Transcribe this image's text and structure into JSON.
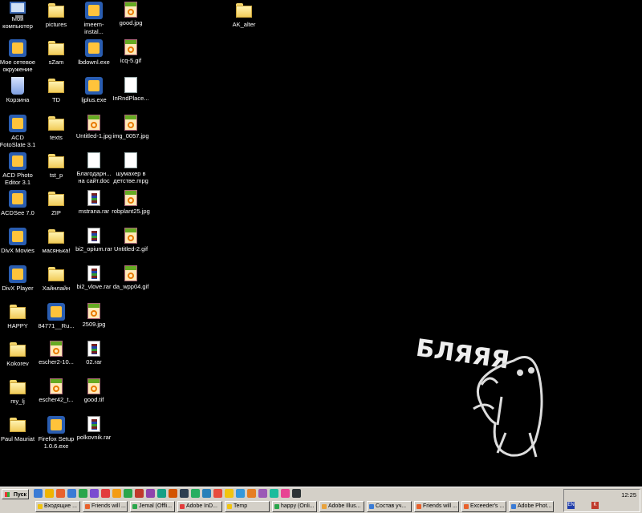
{
  "desktop": {
    "icons": [
      {
        "label": "Мой компьютер",
        "type": "pc"
      },
      {
        "label": "Мое сетевое окружение",
        "type": "app"
      },
      {
        "label": "Корзина",
        "type": "trash"
      },
      {
        "label": "ACD FotoSlate 3.1",
        "type": "app"
      },
      {
        "label": "ACD Photo Editor 3.1",
        "type": "app"
      },
      {
        "label": "ACDSee 7.0",
        "type": "app"
      },
      {
        "label": "DivX Movies",
        "type": "app"
      },
      {
        "label": "DivX Player",
        "type": "app"
      },
      {
        "label": "HAPPY",
        "type": "folder"
      },
      {
        "label": "Kokorev",
        "type": "folder"
      },
      {
        "label": "my_lj",
        "type": "folder"
      },
      {
        "label": "Paul Mauriat",
        "type": "folder"
      },
      {
        "label": "pictures",
        "type": "folder"
      },
      {
        "label": "sZam",
        "type": "folder"
      },
      {
        "label": "TD",
        "type": "folder"
      },
      {
        "label": "texts",
        "type": "folder"
      },
      {
        "label": "tst_p",
        "type": "folder"
      },
      {
        "label": "ZIP",
        "type": "folder"
      },
      {
        "label": "масянька!",
        "type": "folder"
      },
      {
        "label": "Хайнлайн",
        "type": "folder"
      },
      {
        "label": "84771__Ru...",
        "type": "app"
      },
      {
        "label": "escher2-10...",
        "type": "img"
      },
      {
        "label": "escher42_t...",
        "type": "img"
      },
      {
        "label": "Firefox Setup 1.0.6.exe",
        "type": "app"
      },
      {
        "label": "imeem-instal...",
        "type": "app"
      },
      {
        "label": "lbdownl.exe",
        "type": "app"
      },
      {
        "label": "ljplus.exe",
        "type": "app"
      },
      {
        "label": "Untitled-1.jpg",
        "type": "img"
      },
      {
        "label": "Благодарн... на сайт.doc",
        "type": "file"
      },
      {
        "label": "mstrana.rar",
        "type": "rar"
      },
      {
        "label": "bi2_opium.rar",
        "type": "rar"
      },
      {
        "label": "bi2_vlove.rar",
        "type": "rar"
      },
      {
        "label": "2509.jpg",
        "type": "img"
      },
      {
        "label": "02.rar",
        "type": "rar"
      },
      {
        "label": "good.tif",
        "type": "img"
      },
      {
        "label": "polkovnik.rar",
        "type": "rar"
      },
      {
        "label": "good.jpg",
        "type": "img"
      },
      {
        "label": "icq-5.gif",
        "type": "img"
      },
      {
        "label": "InRndPlace...",
        "type": "file"
      },
      {
        "label": "img_0057.jpg",
        "type": "img"
      },
      {
        "label": "шумахер в детстве.mpg",
        "type": "file"
      },
      {
        "label": "robplant25.jpg",
        "type": "img"
      },
      {
        "label": "Untitled-2.gif",
        "type": "img"
      },
      {
        "label": "da_wpp04.gif",
        "type": "img"
      },
      {
        "label": "AK_alter",
        "type": "folder"
      }
    ],
    "wallpaper_text": "БЛЯЯЯ"
  },
  "taskbar": {
    "start_label": "Пуск",
    "quick_launch_colors": [
      "#3a7bd5",
      "#f0b400",
      "#e8612c",
      "#3a7bd5",
      "#2aa64b",
      "#7a4bd0",
      "#e23c3c",
      "#f39c12",
      "#2aa64b",
      "#c0392b",
      "#8e44ad",
      "#16a085",
      "#d35400",
      "#2c3e50",
      "#27ae60",
      "#2980b9",
      "#e74c3c",
      "#f1c40f",
      "#3498db",
      "#e67e22",
      "#9b59b6",
      "#1abc9c",
      "#e84393",
      "#2d3436"
    ],
    "tasks": [
      {
        "label": "Входящие ...",
        "color": "#f1c40f"
      },
      {
        "label": "Friends will ...",
        "color": "#e8612c"
      },
      {
        "label": "Jemal (Offli...",
        "color": "#2aa64b"
      },
      {
        "label": "Adobe InD...",
        "color": "#e23c3c"
      },
      {
        "label": "Temp",
        "color": "#f1c40f"
      },
      {
        "label": "happy (Onli...",
        "color": "#2aa64b"
      },
      {
        "label": "Adobe Illus...",
        "color": "#e8a23c"
      },
      {
        "label": "Состав уч...",
        "color": "#3a7bd5"
      },
      {
        "label": "Friends will ...",
        "color": "#e8612c"
      },
      {
        "label": "Exceeder's ...",
        "color": "#e8612c"
      },
      {
        "label": "Adobe Phot...",
        "color": "#3a7bd5"
      }
    ],
    "clock": "12:25",
    "tray": [
      {
        "label": "EN",
        "color": "#1f3ca8"
      },
      {
        "label": "K",
        "color": "#c0392b"
      }
    ]
  }
}
